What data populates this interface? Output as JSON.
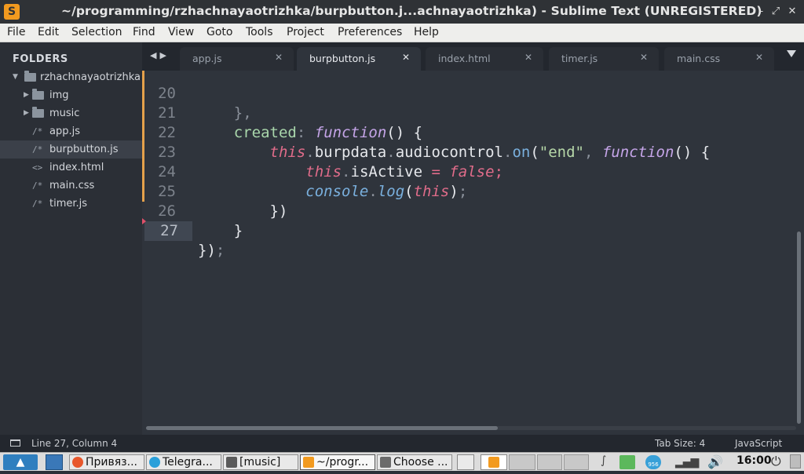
{
  "window": {
    "title": "~/programming/rzhachnayaotrizhka/burpbutton.j...achnayaotrizhka) - Sublime Text (UNREGISTERED)",
    "app_icon": "S",
    "minimize_glyph": "–",
    "maximize_glyph": "⤢",
    "close_glyph": "✕"
  },
  "menubar": {
    "items": [
      "File",
      "Edit",
      "Selection",
      "Find",
      "View",
      "Goto",
      "Tools",
      "Project",
      "Preferences",
      "Help"
    ]
  },
  "sidebar": {
    "title": "FOLDERS",
    "root": "rzhachnayaotrizhka",
    "items": [
      {
        "type": "folder",
        "label": "img"
      },
      {
        "type": "folder",
        "label": "music"
      },
      {
        "type": "file",
        "glyph": "/*",
        "label": "app.js"
      },
      {
        "type": "file",
        "glyph": "/*",
        "label": "burpbutton.js",
        "selected": true
      },
      {
        "type": "file",
        "glyph": "<>",
        "label": "index.html"
      },
      {
        "type": "file",
        "glyph": "/*",
        "label": "main.css"
      },
      {
        "type": "file",
        "glyph": "/*",
        "label": "timer.js"
      }
    ]
  },
  "tabs": {
    "nav_glyph": "◀▶",
    "close_glyph": "✕",
    "items": [
      {
        "label": "app.js",
        "active": false
      },
      {
        "label": "burpbutton.js",
        "active": true
      },
      {
        "label": "index.html",
        "active": false
      },
      {
        "label": "timer.js",
        "active": false
      },
      {
        "label": "main.css",
        "active": false
      }
    ]
  },
  "editor": {
    "line_numbers": [
      "20",
      "21",
      "22",
      "23",
      "24",
      "25",
      "26",
      "27"
    ],
    "current_line": "27"
  },
  "statusbar": {
    "position": "Line 27, Column 4",
    "tab_size": "Tab Size: 4",
    "syntax": "JavaScript"
  },
  "taskbar": {
    "tasks": [
      {
        "label": "Привяз...",
        "icon_color": "#e8572b"
      },
      {
        "label": "Telegra...",
        "icon_color": "#2aa0da"
      },
      {
        "label": "[music]",
        "icon_color": "#5b5b5b"
      },
      {
        "label": "~/progr...",
        "icon_color": "#f29a1f"
      },
      {
        "label": "Choose ...",
        "icon_color": "#6b6b6b"
      }
    ],
    "clock": "16:00",
    "badge": "956"
  },
  "colors": {
    "accent": "#f29a1f",
    "editor_bg": "#2f343c",
    "sidebar_bg": "#2b2f36"
  }
}
